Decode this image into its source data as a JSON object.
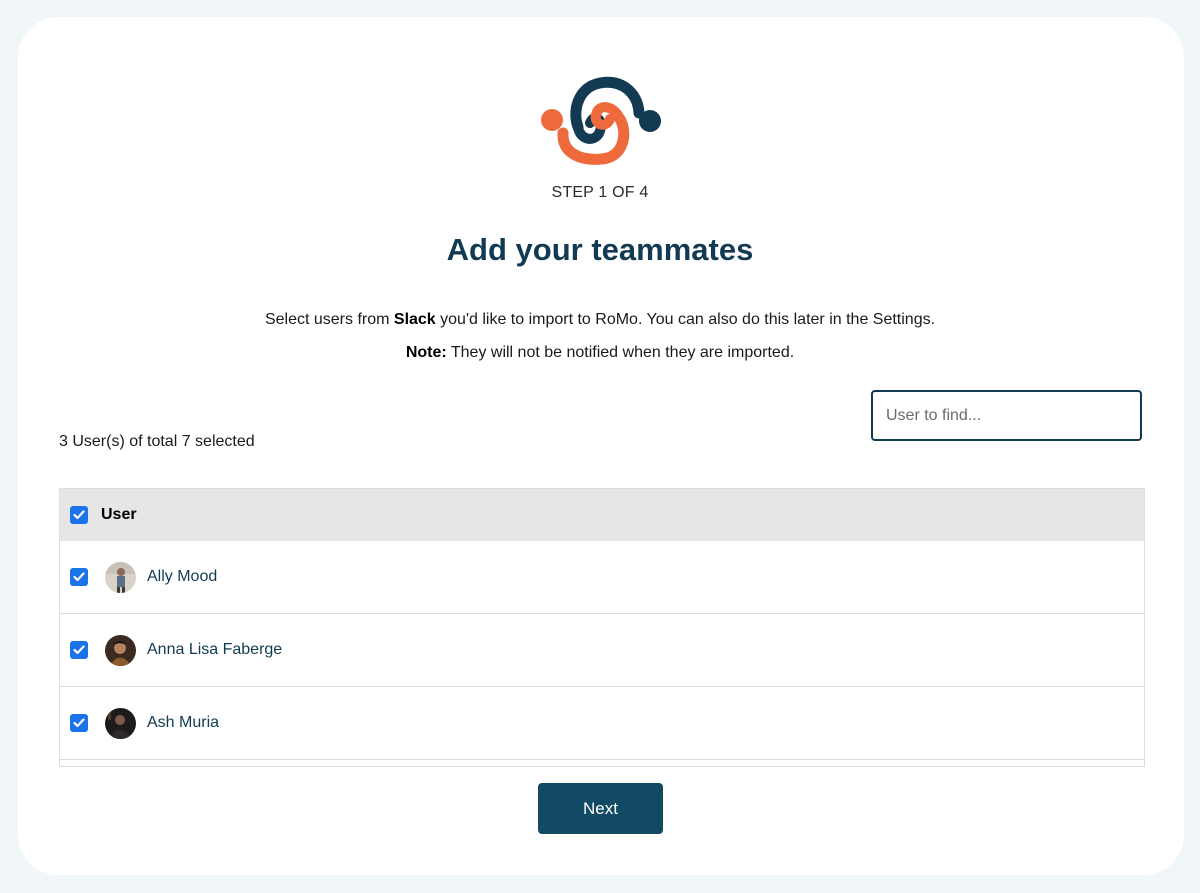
{
  "header": {
    "step": "STEP 1 OF 4",
    "title": "Add your teammates"
  },
  "description": {
    "line1_before": "Select users from ",
    "line1_bold": "Slack",
    "line1_after": " you'd like to import to RoMo. You can also do this later in the Settings.",
    "line2_bold": "Note:",
    "line2_after": " They will not be notified when they are imported."
  },
  "search": {
    "placeholder": "User to find..."
  },
  "selection": {
    "count_text": "3 User(s) of total 7 selected"
  },
  "table": {
    "header_label": "User",
    "rows": [
      {
        "name": "Ally Mood",
        "checked": true
      },
      {
        "name": "Anna Lisa Faberge",
        "checked": true
      },
      {
        "name": "Ash Muria",
        "checked": true
      }
    ]
  },
  "actions": {
    "next_label": "Next"
  },
  "colors": {
    "brand_dark": "#123a52",
    "brand_orange": "#ee6a3c",
    "button": "#124a63",
    "checkbox": "#1a73e8"
  }
}
